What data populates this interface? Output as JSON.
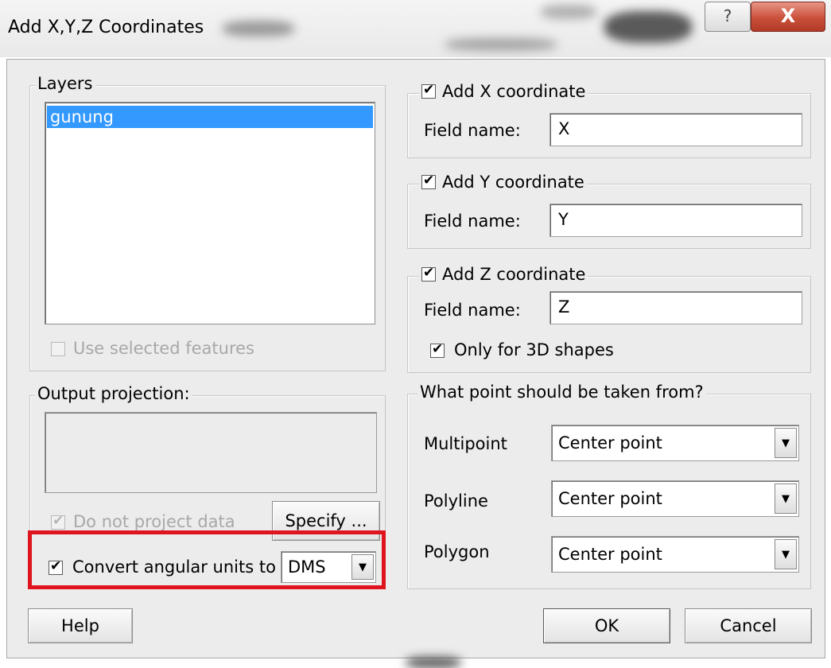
{
  "window": {
    "title": "Add X,Y,Z Coordinates",
    "help_glyph": "?",
    "close_glyph": "X"
  },
  "layers": {
    "legend": "Layers",
    "items": [
      "gunung"
    ],
    "selected_index": 0,
    "use_selected_label": "Use selected features",
    "use_selected_checked": false
  },
  "x_coord": {
    "label": "Add X coordinate",
    "checked": true,
    "field_label": "Field name:",
    "field_value": "X"
  },
  "y_coord": {
    "label": "Add Y coordinate",
    "checked": true,
    "field_label": "Field name:",
    "field_value": "Y"
  },
  "z_coord": {
    "label": "Add Z coordinate",
    "checked": true,
    "field_label": "Field name:",
    "field_value": "Z",
    "only3d_label": "Only for 3D shapes",
    "only3d_checked": true
  },
  "projection": {
    "legend": "Output projection:",
    "do_not_project_label": "Do not project data",
    "do_not_project_checked": true,
    "specify_label": "Specify ...",
    "convert_label": "Convert angular units to",
    "convert_checked": true,
    "angular_unit": "DMS"
  },
  "point_source": {
    "legend": "What point should be taken from?",
    "multipoint_label": "Multipoint",
    "multipoint_value": "Center point",
    "polyline_label": "Polyline",
    "polyline_value": "Center point",
    "polygon_label": "Polygon",
    "polygon_value": "Center point"
  },
  "buttons": {
    "help": "Help",
    "ok": "OK",
    "cancel": "Cancel"
  },
  "colors": {
    "selection": "#3399ff",
    "highlight_box": "#e0141e",
    "close_button": "#c9503b"
  }
}
